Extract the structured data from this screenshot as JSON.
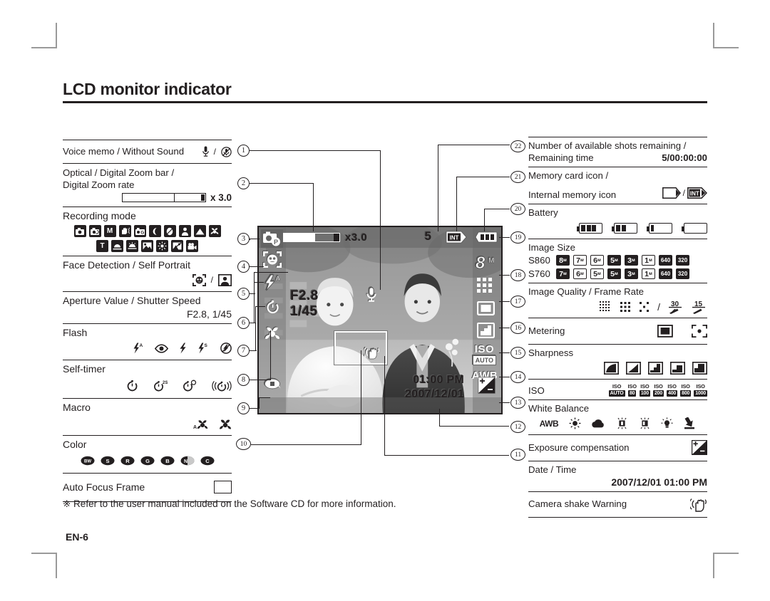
{
  "page": {
    "title": "LCD monitor indicator",
    "footnote": "※ Refer to the user manual included on the Software CD for more information.",
    "page_number": "EN-6"
  },
  "left_column": [
    {
      "callout": "1",
      "label": "Voice memo / Without Sound",
      "icons": [
        "mic-icon",
        "mic-muted-icon"
      ]
    },
    {
      "callout": "2",
      "label": "Optical / Digital Zoom bar /",
      "label2": "Digital Zoom rate",
      "zoom_rate": "x 3.0"
    },
    {
      "callout": "3",
      "label": "Recording mode",
      "icons": [
        "auto-mode-icon",
        "program-mode-icon",
        "manual-mode-icon",
        "dis-mode-icon",
        "photo-help-icon",
        "night-mode-icon",
        "portrait-mode-icon",
        "children-mode-icon",
        "landscape-mode-icon",
        "close-up-mode-icon",
        "text-mode-icon",
        "sunset-mode-icon",
        "dawn-mode-icon",
        "backlight-mode-icon",
        "fireworks-mode-icon",
        "beach-snow-mode-icon",
        "movie-mode-icon"
      ]
    },
    {
      "callout": "4",
      "label": "Face Detection / Self Portrait",
      "icons": [
        "face-detection-icon",
        "self-portrait-icon"
      ]
    },
    {
      "callout": "5",
      "label": "Aperture Value / Shutter Speed",
      "value": "F2.8, 1/45"
    },
    {
      "callout": "6",
      "label": "Flash",
      "icons": [
        "flash-auto-icon",
        "red-eye-icon",
        "fill-flash-icon",
        "slow-sync-icon",
        "flash-off-icon"
      ]
    },
    {
      "callout": "7",
      "label": "Self-timer",
      "icons": [
        "timer-10s-icon",
        "timer-2s-icon",
        "timer-double-icon",
        "timer-motion-icon"
      ]
    },
    {
      "callout": "8",
      "label": "Macro",
      "icons": [
        "auto-macro-icon",
        "macro-icon"
      ]
    },
    {
      "callout": "9",
      "label": "Color",
      "icons": [
        "color-bw-icon",
        "color-s-icon",
        "color-r-icon",
        "color-g-icon",
        "color-b-icon",
        "color-n-icon",
        "color-c-icon"
      ]
    },
    {
      "callout": "10",
      "label": "Auto Focus Frame",
      "icons": [
        "af-frame-icon"
      ]
    }
  ],
  "right_column": [
    {
      "callout": "22",
      "label": "Number of available shots remaining /",
      "label2": "Remaining time",
      "value": "5/00:00:00"
    },
    {
      "callout": "21",
      "label": "Memory card icon /",
      "label2": "Internal memory icon",
      "icons": [
        "memory-card-icon",
        "internal-memory-icon"
      ]
    },
    {
      "callout": "20",
      "label": "Battery",
      "icons": [
        "battery-full-icon",
        "battery-two-thirds-icon",
        "battery-low-icon",
        "battery-empty-icon"
      ]
    },
    {
      "callout": "19",
      "label": "Image Size",
      "model_a": "S860",
      "model_b": "S760",
      "sizes_a": [
        "8",
        "7",
        "6",
        "5",
        "3",
        "1",
        "640",
        "320"
      ],
      "sizes_b": [
        "7",
        "6",
        "5",
        "5",
        "3",
        "1",
        "640",
        "320"
      ]
    },
    {
      "callout": "18",
      "label": "Image Quality / Frame Rate",
      "icons": [
        "superfine-icon",
        "fine-icon",
        "normal-icon",
        "fps30-icon",
        "fps15-icon"
      ],
      "fps": [
        "30",
        "15"
      ]
    },
    {
      "callout": "17",
      "label": "Metering",
      "icons": [
        "multi-metering-icon",
        "spot-metering-icon"
      ]
    },
    {
      "callout": "16",
      "label": "Sharpness",
      "icons": [
        "sharpness-1-icon",
        "sharpness-2-icon",
        "sharpness-3-icon",
        "sharpness-4-icon",
        "sharpness-5-icon"
      ]
    },
    {
      "callout": "15",
      "label": "ISO",
      "values": [
        "AUTO",
        "80",
        "100",
        "200",
        "400",
        "800",
        "1000"
      ]
    },
    {
      "callout": "14",
      "label": "White Balance",
      "icons": [
        "awb-icon",
        "daylight-icon",
        "cloudy-icon",
        "fluorescent-h-icon",
        "fluorescent-l-icon",
        "tungsten-icon",
        "custom-wb-icon"
      ]
    },
    {
      "callout": "13",
      "label": "Exposure compensation",
      "icons": [
        "exposure-compensation-icon"
      ]
    },
    {
      "callout": "12",
      "label": "Date / Time",
      "value": "2007/12/01  01:00 PM"
    },
    {
      "callout": "11",
      "label": "Camera shake Warning",
      "icons": [
        "camera-shake-icon"
      ]
    }
  ],
  "lcd": {
    "zoom_rate": "x3.0",
    "shots_remaining": "5",
    "memory_icon": "internal-memory-icon",
    "memory_label": "INT",
    "battery": "battery-full-icon",
    "image_size": "8",
    "image_size_unit": "M",
    "mode_letter": "P",
    "aperture": "F2.8",
    "shutter": "1/45",
    "time": "01:00 PM",
    "date": "2007/12/01",
    "iso_label": "ISO",
    "iso_value": "AUTO",
    "white_balance": "AWB",
    "flash_mode": "flash-auto-icon",
    "self_timer": "timer-10s-icon",
    "macro": "macro-icon",
    "color": "color-icon",
    "face_detection": "face-detection-icon",
    "voice_memo": "mic-icon",
    "camera_shake": "camera-shake-icon"
  },
  "colors": {
    "ink": "#231f20",
    "crop_mark": "#9a9a9a",
    "lcd_overlay": "rgba(100,100,100,0.45)"
  }
}
